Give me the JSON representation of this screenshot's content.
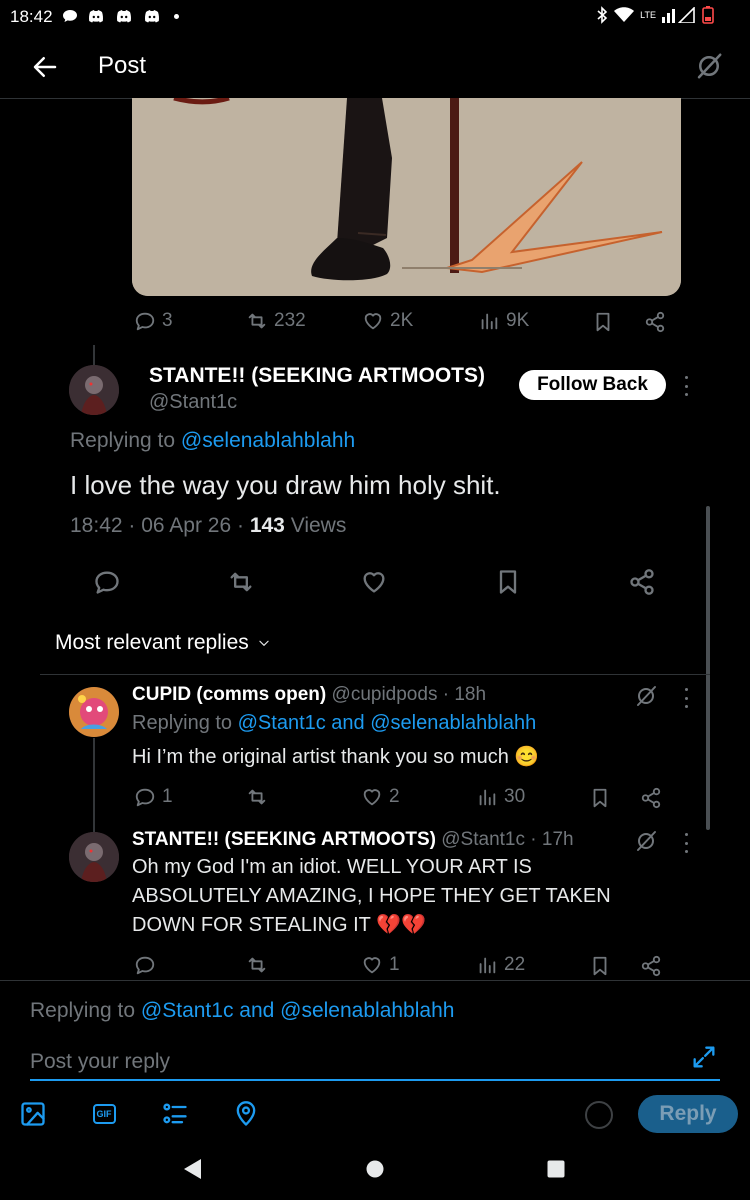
{
  "status_bar": {
    "time": "18:42",
    "net_label": "LTE"
  },
  "header": {
    "title": "Post"
  },
  "post": {
    "stats": {
      "replies": "3",
      "reposts": "232",
      "likes": "2K",
      "views": "9K"
    }
  },
  "main_reply": {
    "display_name": "STANTE!! (SEEKING ARTMOOTS)",
    "handle": "@Stant1c",
    "follow_label": "Follow Back",
    "replying_prefix": "Replying to",
    "replying_to": "@selenablahblahh",
    "text": "I love the way you draw him holy shit.",
    "time": "18:42",
    "date": "06 Apr 26",
    "views_count": "143",
    "views_label": "Views"
  },
  "replies_header": {
    "label": "Most relevant replies"
  },
  "replies": [
    {
      "display_name": "CUPID (comms open)",
      "handle": "@cupidpods",
      "age": "18h",
      "replying_prefix": "Replying to",
      "replying_to": "@Stant1c and @selenablahblahh",
      "text": "Hi I’m the original artist thank you so much 😊",
      "replies": "1",
      "reposts": "",
      "likes": "2",
      "views": "30"
    },
    {
      "display_name": "STANTE!! (SEEKING ARTMOOTS)",
      "handle": "@Stant1c",
      "age": "17h",
      "text_lines": [
        "Oh my God I'm an idiot. WELL YOUR ART IS",
        "ABSOLUTELY AMAZING, I HOPE THEY GET TAKEN",
        "DOWN FOR STEALING IT 💔💔"
      ],
      "replies": "",
      "reposts": "",
      "likes": "1",
      "views": "22"
    }
  ],
  "composer": {
    "replying_prefix": "Replying to",
    "replying_to": "@Stant1c and @selenablahblahh",
    "placeholder": "Post your reply",
    "reply_label": "Reply",
    "gif_label": "GIF"
  },
  "colors": {
    "accent": "#1d9bf0",
    "muted": "#71767b",
    "background": "#000000",
    "heart_emoji": "#e0245e"
  }
}
